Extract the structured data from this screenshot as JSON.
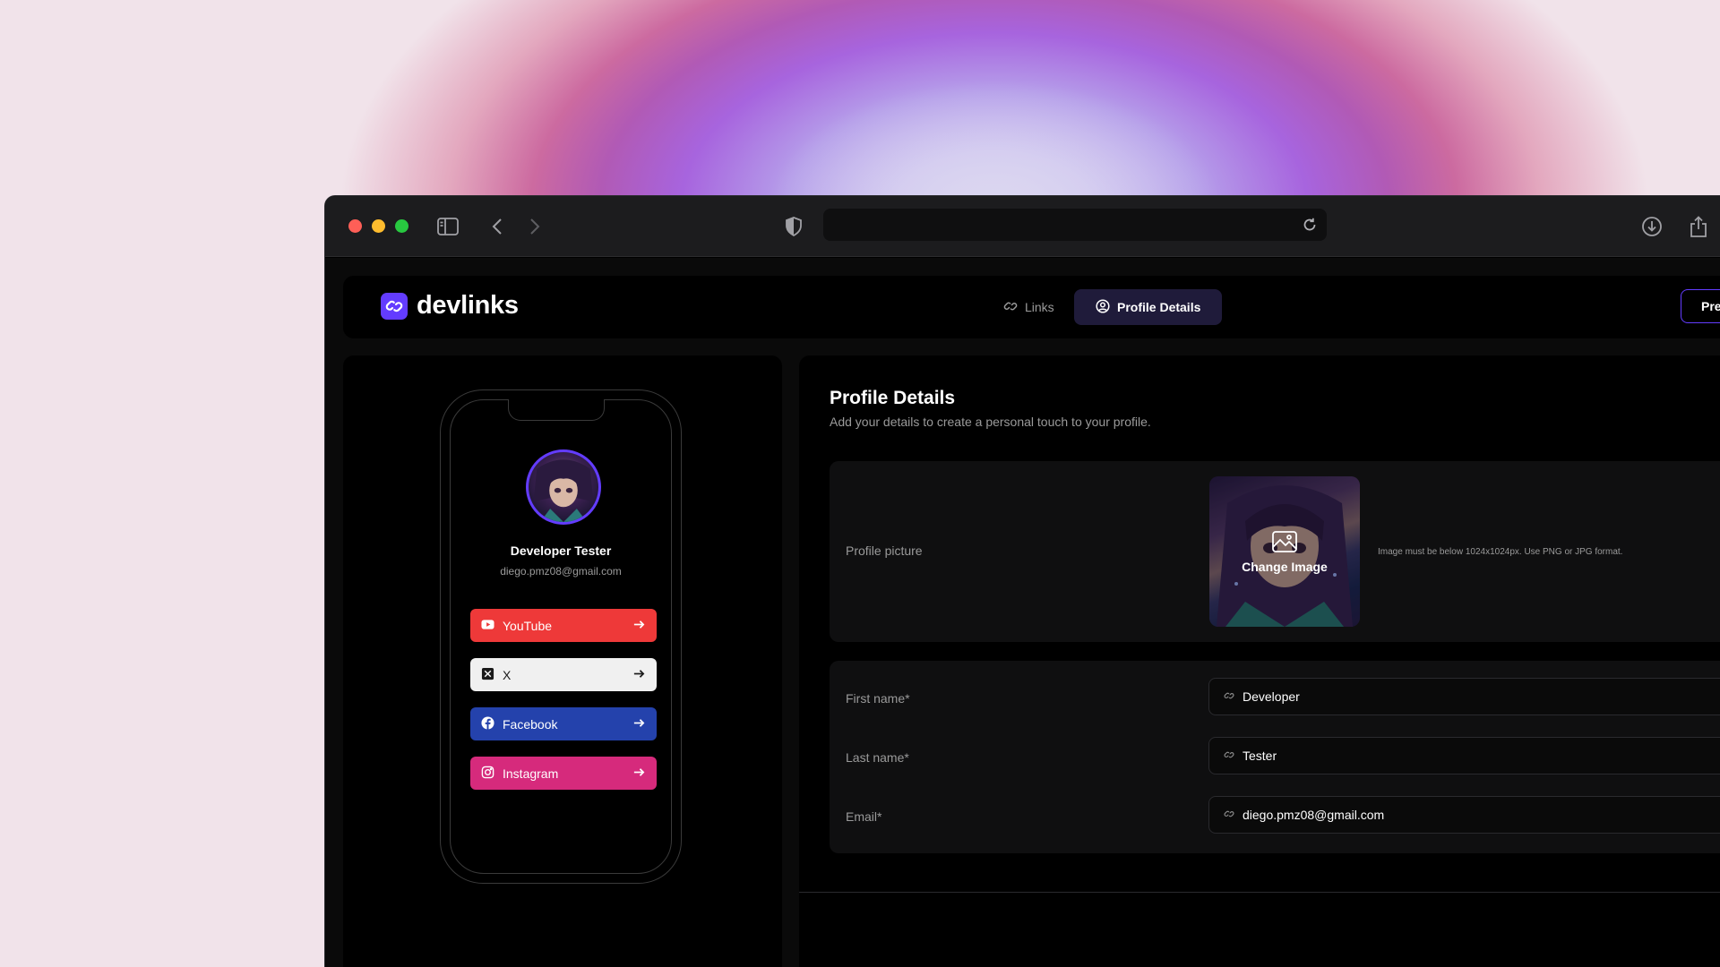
{
  "app": {
    "logo_text": "devlinks",
    "tabs": [
      {
        "label": "Links",
        "icon": "link-icon",
        "active": false
      },
      {
        "label": "Profile Details",
        "icon": "user-circle-icon",
        "active": true
      }
    ],
    "preview_label": "Previe",
    "accent_color": "#633cff"
  },
  "preview": {
    "name": "Developer Tester",
    "email": "diego.pmz08@gmail.com",
    "links": [
      {
        "platform": "YouTube",
        "icon": "youtube-icon",
        "color": "#ee3939"
      },
      {
        "platform": "X",
        "icon": "x-logo-icon",
        "color": "#f0f0f0"
      },
      {
        "platform": "Facebook",
        "icon": "facebook-icon",
        "color": "#2442ac"
      },
      {
        "platform": "Instagram",
        "icon": "instagram-icon",
        "color": "#d62a7c"
      }
    ]
  },
  "profile": {
    "title": "Profile Details",
    "subtitle": "Add your details to create a personal touch to your profile.",
    "picture_label": "Profile picture",
    "change_image_label": "Change Image",
    "picture_hint": "Image must be below 1024x1024px. Use PNG or JPG format.",
    "fields": [
      {
        "label": "First name*",
        "value": "Developer"
      },
      {
        "label": "Last name*",
        "value": "Tester"
      },
      {
        "label": "Email*",
        "value": "diego.pmz08@gmail.com"
      }
    ]
  }
}
